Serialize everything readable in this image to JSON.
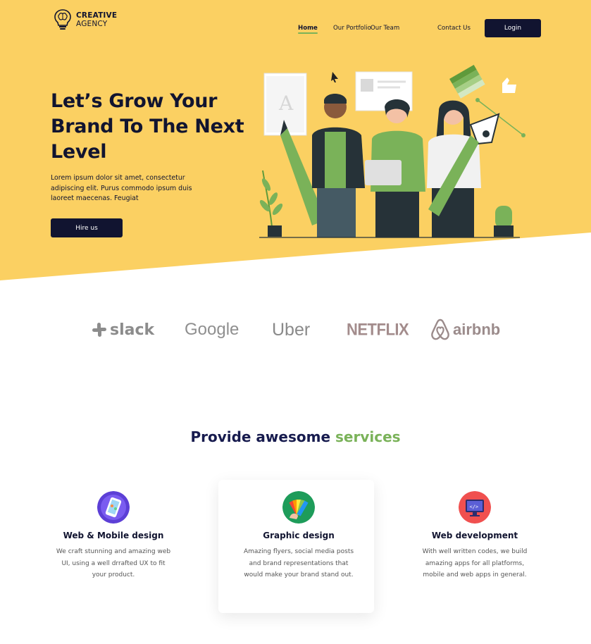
{
  "brand": {
    "line1": "CREATIVE",
    "line2": "AGENCY"
  },
  "nav": {
    "items": [
      "Home",
      "Our Portfolio",
      "Our Team",
      "Contact Us"
    ],
    "active": "Home",
    "login": "Login"
  },
  "hero": {
    "title": "Let’s Grow Your Brand To The Next Level",
    "description": "Lorem ipsum dolor sit amet, consectetur adipiscing elit. Purus commodo ipsum duis laoreet maecenas. Feugiat",
    "cta": "Hire us"
  },
  "clients": [
    "slack",
    "Google",
    "Uber",
    "NETFLIX",
    "airbnb"
  ],
  "services": {
    "title_prefix": "Provide awesome",
    "title_accent": "services",
    "items": [
      {
        "name": "Web & Mobile design",
        "description": "We craft stunning and amazing web UI, using a well drrafted UX to fit your product.",
        "icon": "mobile-design-icon"
      },
      {
        "name": "Graphic design",
        "description": "Amazing flyers, social media posts and brand representations that would make your brand stand out.",
        "icon": "color-palette-icon"
      },
      {
        "name": "Web development",
        "description": "With well written codes, we build amazing apps for all platforms, mobile and web apps in general.",
        "icon": "code-monitor-icon"
      }
    ]
  },
  "colors": {
    "hero_bg": "#FBD062",
    "dark": "#111430",
    "accent": "#7AB259"
  }
}
